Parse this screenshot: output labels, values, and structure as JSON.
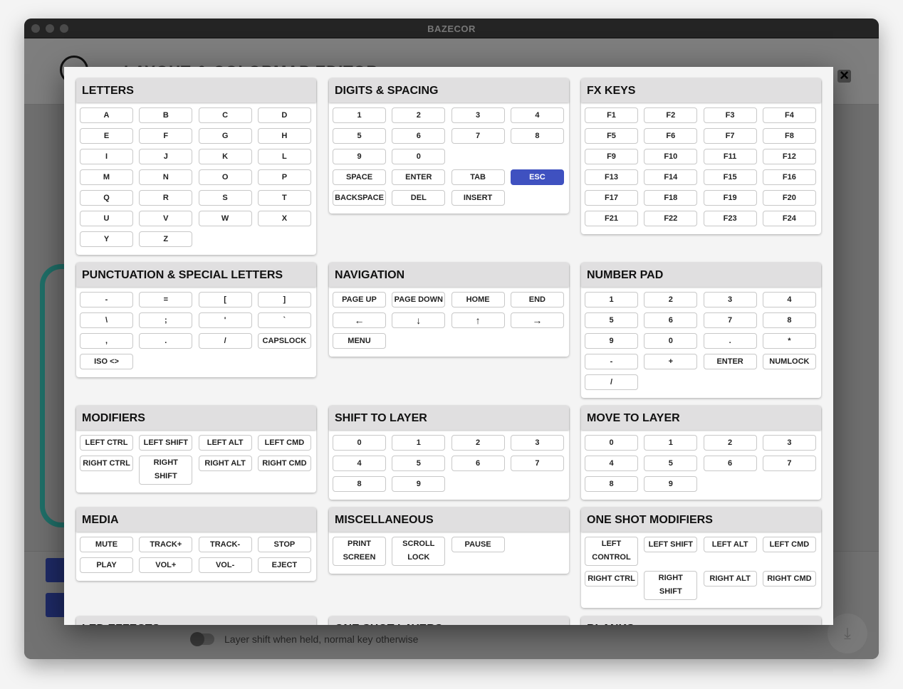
{
  "app": {
    "title": "BAZECOR",
    "background_title": "LAYOUT & COLORMAP EDITOR",
    "toggle_label": "Layer shift when held, normal key otherwise"
  },
  "colors": {
    "active_key": "#3f51c0",
    "keyboard_accent": "#1f6f68"
  },
  "modal": {
    "close_icon": "close-icon",
    "sections": [
      {
        "title": "LETTERS",
        "keys": [
          "A",
          "B",
          "C",
          "D",
          "E",
          "F",
          "G",
          "H",
          "I",
          "J",
          "K",
          "L",
          "M",
          "N",
          "O",
          "P",
          "Q",
          "R",
          "S",
          "T",
          "U",
          "V",
          "W",
          "X",
          "Y",
          "Z"
        ]
      },
      {
        "title": "DIGITS & SPACING",
        "keys": [
          "1",
          "2",
          "3",
          "4",
          "5",
          "6",
          "7",
          "8",
          "9",
          "0",
          "",
          "",
          "SPACE",
          "ENTER",
          "TAB",
          "ESC",
          "BACKSPACE",
          "DEL",
          "INSERT"
        ],
        "active": "ESC"
      },
      {
        "title": "FX KEYS",
        "keys": [
          "F1",
          "F2",
          "F3",
          "F4",
          "F5",
          "F6",
          "F7",
          "F8",
          "F9",
          "F10",
          "F11",
          "F12",
          "F13",
          "F14",
          "F15",
          "F16",
          "F17",
          "F18",
          "F19",
          "F20",
          "F21",
          "F22",
          "F23",
          "F24"
        ]
      },
      {
        "title": "PUNCTUATION & SPECIAL LETTERS",
        "keys": [
          "-",
          "=",
          "[",
          "]",
          "\\",
          ";",
          "'",
          "`",
          ",",
          ".",
          "/",
          "CAPSLOCK",
          "ISO <>"
        ]
      },
      {
        "title": "NAVIGATION",
        "keys": [
          "PAGE UP",
          "PAGE DOWN",
          "HOME",
          "END",
          "←",
          "↓",
          "↑",
          "→",
          "MENU"
        ]
      },
      {
        "title": "NUMBER PAD",
        "keys": [
          "1",
          "2",
          "3",
          "4",
          "5",
          "6",
          "7",
          "8",
          "9",
          "0",
          ".",
          "*",
          "-",
          "+",
          "ENTER",
          "NUMLOCK",
          "/"
        ]
      },
      {
        "title": "MODIFIERS",
        "keys": [
          "LEFT CTRL",
          "LEFT SHIFT",
          "LEFT ALT",
          "LEFT CMD",
          "RIGHT CTRL",
          "RIGHT\nSHIFT",
          "RIGHT ALT",
          "RIGHT CMD"
        ]
      },
      {
        "title": "SHIFT TO LAYER",
        "keys": [
          "0",
          "1",
          "2",
          "3",
          "4",
          "5",
          "6",
          "7",
          "8",
          "9"
        ]
      },
      {
        "title": "MOVE TO LAYER",
        "keys": [
          "0",
          "1",
          "2",
          "3",
          "4",
          "5",
          "6",
          "7",
          "8",
          "9"
        ]
      },
      {
        "title": "MEDIA",
        "keys": [
          "MUTE",
          "TRACK+",
          "TRACK-",
          "STOP",
          "PLAY",
          "VOL+",
          "VOL-",
          "EJECT"
        ]
      },
      {
        "title": "MISCELLANEOUS",
        "keys": [
          "PRINT\nSCREEN",
          "SCROLL\nLOCK",
          "PAUSE"
        ]
      },
      {
        "title": "ONE SHOT MODIFIERS",
        "keys": [
          "LEFT\nCONTROL",
          "LEFT SHIFT",
          "LEFT ALT",
          "LEFT CMD",
          "RIGHT CTRL",
          "RIGHT\nSHIFT",
          "RIGHT ALT",
          "RIGHT CMD"
        ]
      },
      {
        "title": "LED EFFECTS",
        "keys": []
      },
      {
        "title": "ONE SHOT LAYERS",
        "keys": []
      },
      {
        "title": "BLANKS",
        "keys": []
      }
    ]
  }
}
